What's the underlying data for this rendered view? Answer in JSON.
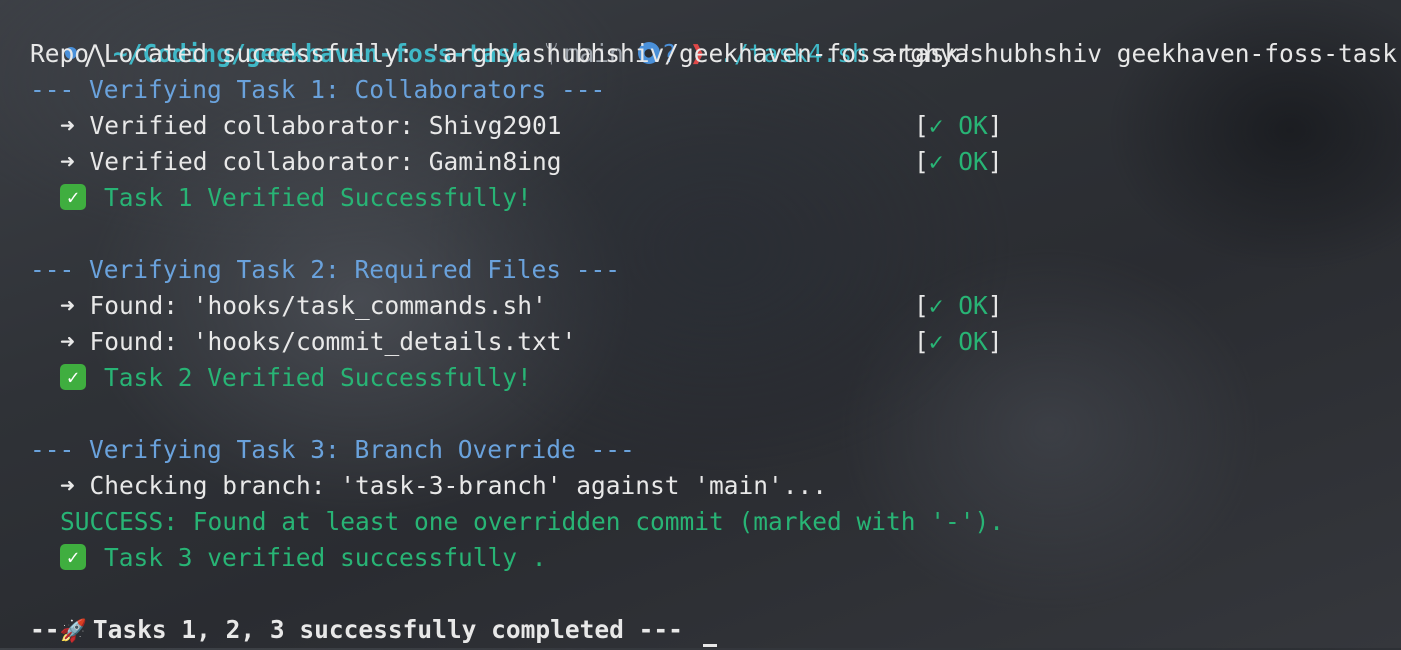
{
  "prompt": {
    "logo_icon": "arch-linux-icon",
    "path": "~/Coding/geekhaven-foss-task",
    "branch_icon": "git-branch-icon",
    "branch": "main",
    "github_icon": "github-icon",
    "status": "?",
    "prompt_symbol": "❱",
    "command": "./task4.sh",
    "args": "arghyashubhshiv geekhaven-foss-task"
  },
  "output": {
    "repo_located": "Repo Located successfully: 'arghyashubhshiv/geekhaven-foss-task'",
    "task1": {
      "header": "--- Verifying Task 1: Collaborators ---",
      "items": [
        {
          "text": "➜ Verified collaborator: Shivg2901",
          "status": "✓ OK"
        },
        {
          "text": "➜ Verified collaborator: Gamin8ing",
          "status": "✓ OK"
        }
      ],
      "result_icon": "check-mark-emoji",
      "result": "Task 1 Verified Successfully!"
    },
    "task2": {
      "header": "--- Verifying Task 2: Required Files ---",
      "items": [
        {
          "text": "➜ Found: 'hooks/task_commands.sh'",
          "status": "✓ OK"
        },
        {
          "text": "➜ Found: 'hooks/commit_details.txt'",
          "status": "✓ OK"
        }
      ],
      "result_icon": "check-mark-emoji",
      "result": "Task 2 Verified Successfully!"
    },
    "task3": {
      "header": "--- Verifying Task 3: Branch Override ---",
      "checking": "➜ Checking branch: 'task-3-branch' against 'main'...",
      "success": "SUCCESS: Found at least one overridden commit (marked with '-').",
      "result_icon": "check-mark-emoji",
      "result": "Task 3 verified successfully ."
    },
    "final": {
      "prefix": "--",
      "icon": "rocket-emoji",
      "text": "Tasks 1, 2, 3 successfully completed ---"
    }
  },
  "colors": {
    "path": "#3fb8c7",
    "header_blue": "#6aa2dc",
    "success_green": "#28b475",
    "prompt_red": "#e04848",
    "text": "#e8e8e8",
    "muted": "#9aa0a8"
  }
}
